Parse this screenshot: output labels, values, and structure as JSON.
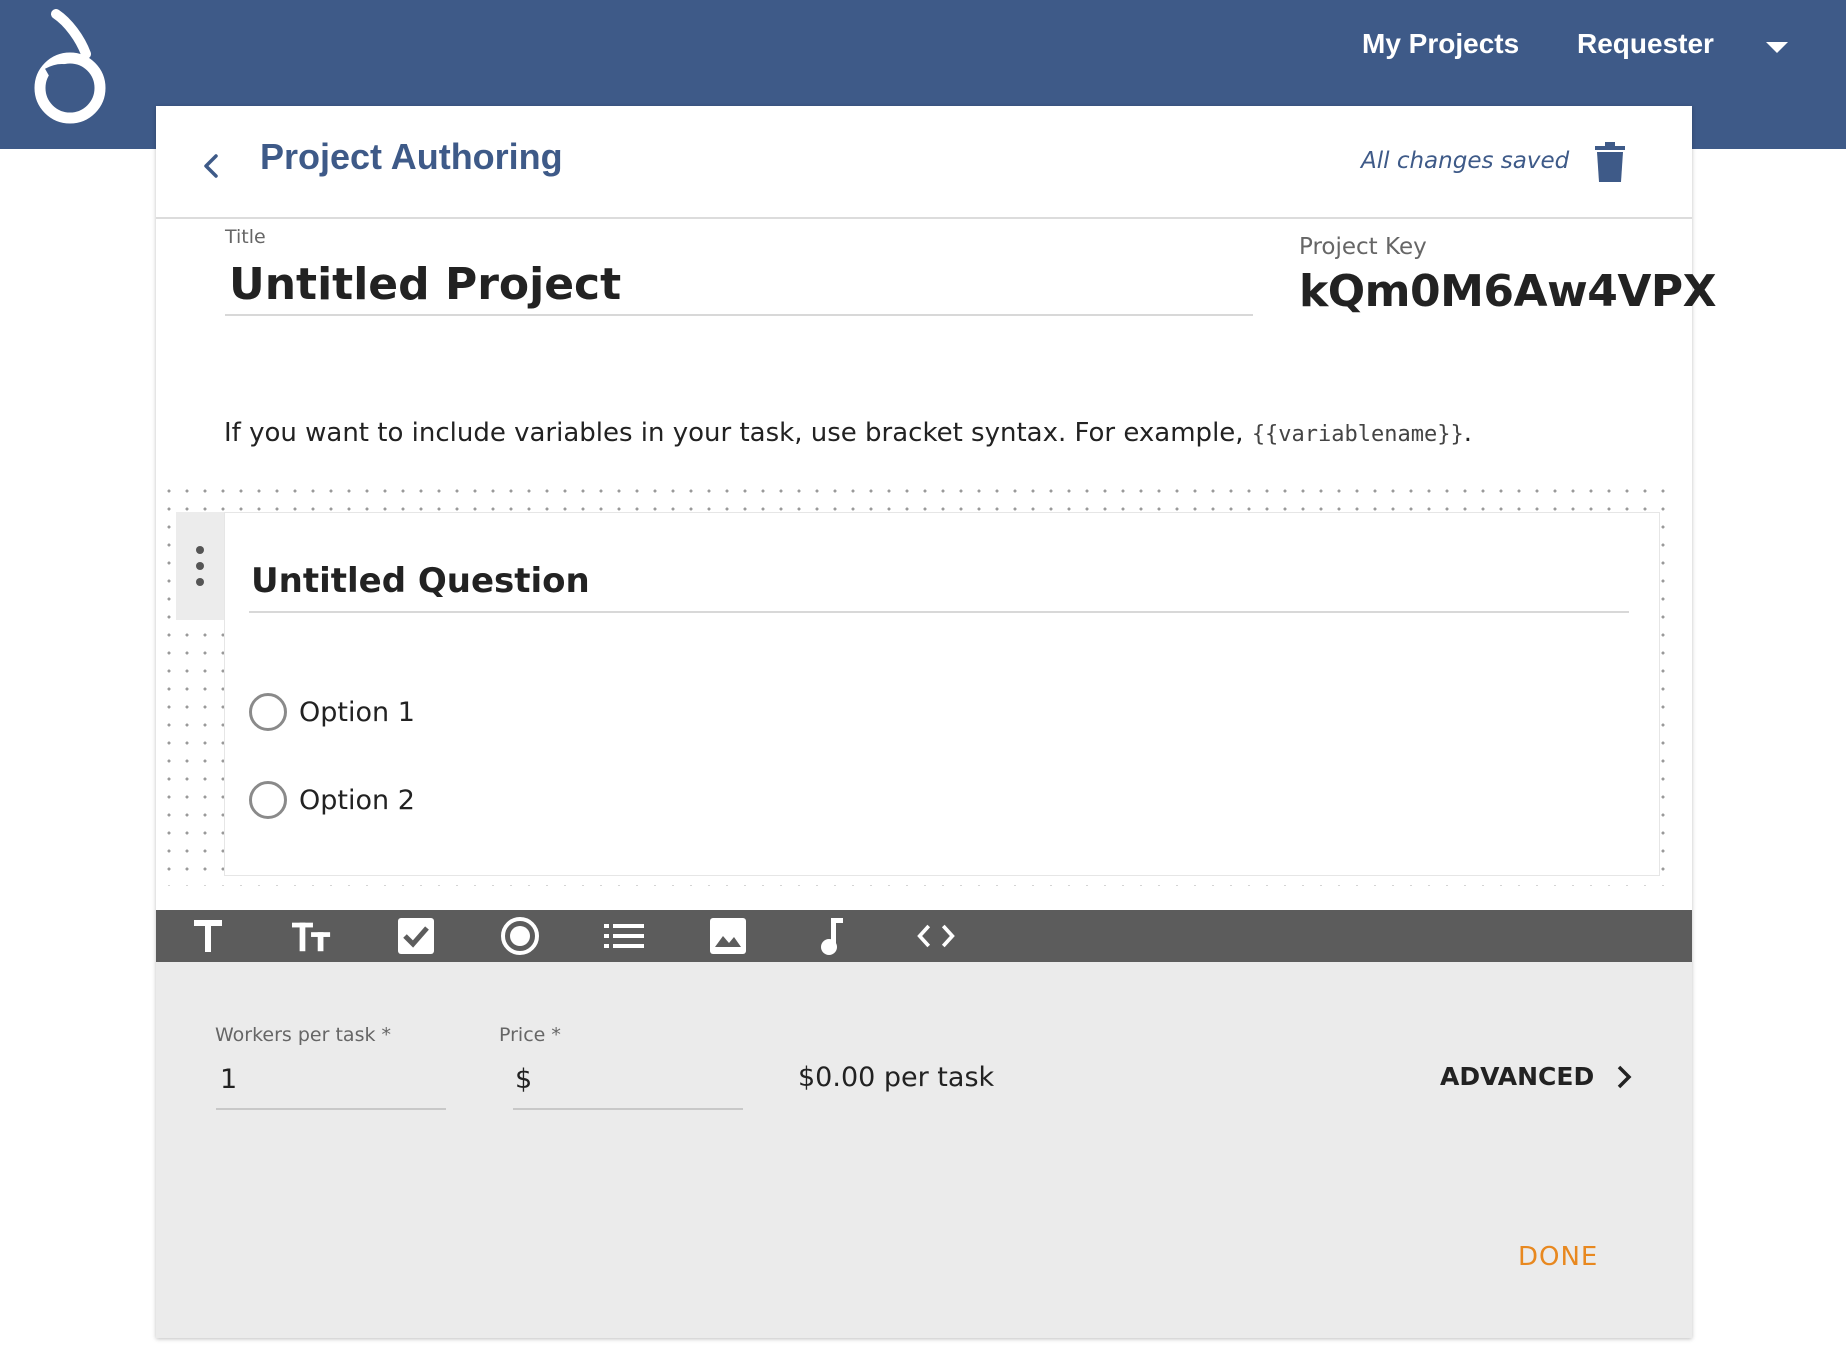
{
  "nav": {
    "my_projects": "My Projects",
    "requester": "Requester",
    "brand_color": "#3e5a88"
  },
  "header": {
    "title": "Project Authoring",
    "saved_status": "All changes saved"
  },
  "project": {
    "title_label": "Title",
    "title_value": "Untitled Project",
    "key_label": "Project Key",
    "key_value": "kQm0M6Aw4VPX"
  },
  "hint": {
    "text_before": "If you want to include variables in your task, use bracket syntax. For example, ",
    "code": "{{variablename}}",
    "text_after": "."
  },
  "question": {
    "title": "Untitled Question",
    "options": [
      "Option 1",
      "Option 2"
    ]
  },
  "toolbar": {
    "tools": [
      "text-icon",
      "heading-text-icon",
      "checkbox-icon",
      "radio-button-icon",
      "list-icon",
      "image-icon",
      "audio-note-icon",
      "code-icon"
    ]
  },
  "settings": {
    "workers_label": "Workers per task *",
    "workers_value": "1",
    "price_label": "Price *",
    "price_value": "$",
    "per_task": "$0.00 per task",
    "advanced_label": "ADVANCED",
    "done_label": "DONE",
    "done_color": "#e8881f"
  }
}
